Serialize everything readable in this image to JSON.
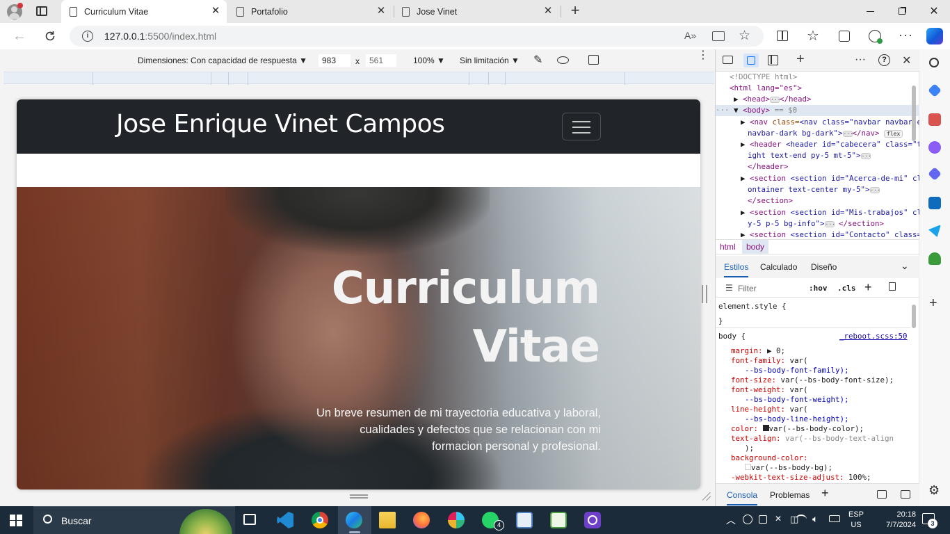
{
  "browser": {
    "tabs": [
      {
        "title": "Curriculum Vitae",
        "active": true
      },
      {
        "title": "Portafolio",
        "active": false
      },
      {
        "title": "Jose Vinet",
        "active": false
      }
    ],
    "url_host": "127.0.0.1",
    "url_path": ":5500/index.html"
  },
  "device_toolbar": {
    "dimensions_label": "Dimensiones: Con capacidad de respuesta",
    "width": "983",
    "times": "x",
    "height": "561",
    "zoom": "100%",
    "throttle": "Sin limitación"
  },
  "site": {
    "brand": "Jose Enrique Vinet Campos",
    "hero_title_line1": "Curriculum",
    "hero_title_line2": "Vitae",
    "hero_lead_1": "Un breve resumen de mi trayectoria educativa y laboral,",
    "hero_lead_2": "cualidades y defectos que se relacionan con mi",
    "hero_lead_3": "formacion personal y profesional."
  },
  "devtools": {
    "dom": {
      "doctype": "<!DOCTYPE html>",
      "html_open": "<html lang=\"es\">",
      "head": "<head>",
      "head_close": "</head>",
      "body": "<body>",
      "body_sel": "== $0",
      "nav_a": "<nav class=\"navbar navbar-expand-lg",
      "nav_b": "navbar-dark bg-dark\">",
      "nav_close": "</nav>",
      "flex": "flex",
      "header_a": "<header id=\"cabecera\" class=\"text-l",
      "header_b": "ight text-end py-5 mt-5\">",
      "header_close": "</header>",
      "sec1_a": "<section id=\"Acerca-de-mi\" class=\"c",
      "sec1_b": "ontainer text-center my-5\">",
      "sec1_close": "</section>",
      "sec2_a": "<section id=\"Mis-trabajos\" class=\"m",
      "sec2_b": "y-5 p-5 bg-info\">",
      "sec2_close": "</section>",
      "sec3_a": "<section id=\"Contacto\" class=\"conta"
    },
    "crumbs": [
      "html",
      "body"
    ],
    "style_tabs": [
      "Estilos",
      "Calculado",
      "Diseño"
    ],
    "filter_placeholder": "Filter",
    "hov": ":hov",
    "cls": ".cls",
    "rules": {
      "element_style": "element.style {",
      "close": "}",
      "body_sel": "body {",
      "source": "_reboot.scss:50",
      "margin": "margin:",
      "margin_v": "0;",
      "ff": "font-family:",
      "var": "var(",
      "ff_v": "--bs-body-font-family);",
      "fs": "font-size:",
      "fs_v": "var(--bs-body-font-size);",
      "fw": "font-weight:",
      "fw_v": "--bs-body-font-weight);",
      "lh": "line-height:",
      "lh_v": "--bs-body-line-height);",
      "color": "color:",
      "color_v": "var(--bs-body-color);",
      "ta": "text-align:",
      "ta_v": "var(--bs-body-text-align",
      "paren": ");",
      "bg": "background-color:",
      "bg_v": "var(--bs-body-bg);",
      "wk": "-webkit-text-size-adjust:",
      "wk_v": "100%;"
    },
    "drawer_tabs": [
      "Consola",
      "Problemas"
    ]
  },
  "taskbar": {
    "search": "Buscar",
    "lang1": "ESP",
    "lang2": "US",
    "time": "20:18",
    "date": "7/7/2024",
    "whatsapp_badge": "4",
    "notif_badge": "3"
  }
}
